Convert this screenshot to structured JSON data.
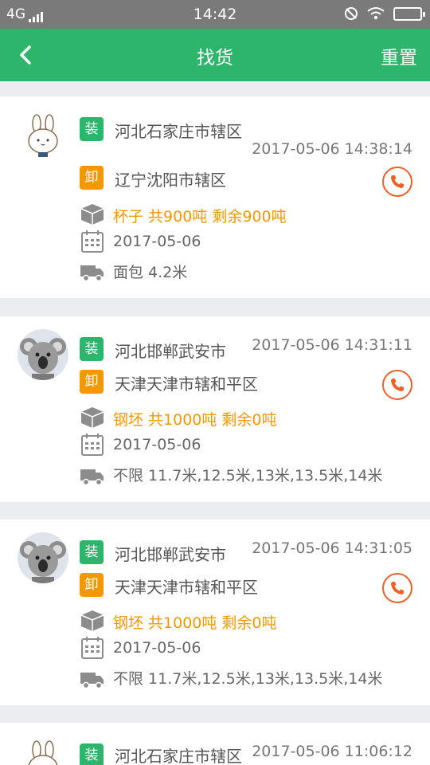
{
  "status_bar": {
    "network": "4G",
    "time": "14:42"
  },
  "header": {
    "title": "找货",
    "reset_label": "重置"
  },
  "colors": {
    "brand_green": "#2db56c",
    "unload_orange": "#f39800",
    "phone_red": "#e8622a"
  },
  "orders": [
    {
      "avatar": "bunny-avatar",
      "load_tag": "装",
      "load_address": "河北石家庄市辖区",
      "timestamp": "2017-05-06 14:38:14",
      "unload_tag": "卸",
      "unload_address": "辽宁沈阳市辖区",
      "goods": "杯子 共900吨 剩余900吨",
      "date": "2017-05-06",
      "truck": "面包 4.2米"
    },
    {
      "avatar": "koala-avatar",
      "load_tag": "装",
      "load_address": "河北邯郸武安市",
      "timestamp": "2017-05-06 14:31:11",
      "unload_tag": "卸",
      "unload_address": "天津天津市辖和平区",
      "goods": "钢坯 共1000吨 剩余0吨",
      "date": "2017-05-06",
      "truck": "不限 11.7米,12.5米,13米,13.5米,14米"
    },
    {
      "avatar": "koala-avatar",
      "load_tag": "装",
      "load_address": "河北邯郸武安市",
      "timestamp": "2017-05-06 14:31:05",
      "unload_tag": "卸",
      "unload_address": "天津天津市辖和平区",
      "goods": "钢坯 共1000吨 剩余0吨",
      "date": "2017-05-06",
      "truck": "不限 11.7米,12.5米,13米,13.5米,14米"
    },
    {
      "avatar": "bunny-avatar",
      "load_tag": "装",
      "load_address": "河北石家庄市辖区",
      "timestamp": "2017-05-06 11:06:12"
    }
  ]
}
